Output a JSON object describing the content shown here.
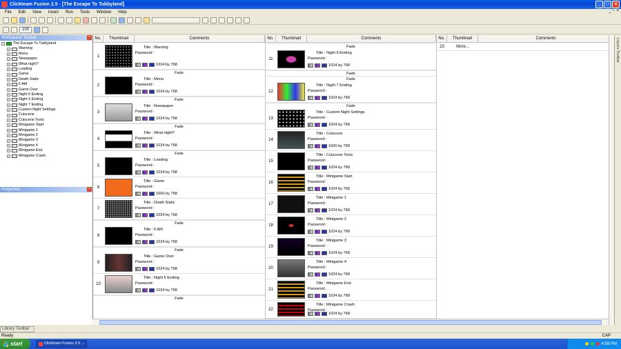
{
  "window": {
    "title": "Clickteam Fusion 2.5 - [The Escape To Tubbyland]"
  },
  "menu": [
    "File",
    "Edit",
    "View",
    "Insert",
    "Run",
    "Tools",
    "Window",
    "Help"
  ],
  "mdi_buttons": [
    "_",
    "▫",
    "×"
  ],
  "toolbar": {
    "zoom_value": "100"
  },
  "workspace": {
    "title": "Workspace Toolbar",
    "root": "The Escape To Tubbyland",
    "frames": [
      "Warning",
      "Menu",
      "Newspaper",
      "What night?",
      "Loading",
      "Game",
      "Death Static",
      "6 AM",
      "Game Over",
      "Night 5 Ending",
      "Night 6 Ending",
      "Night 7 Ending",
      "Custom Night Settings",
      "Cutscene",
      "Cutscene Texts",
      "Minigame Start",
      "Minigame 1",
      "Minigame 2",
      "Minigame 3",
      "Minigame 4",
      "Minigame End",
      "Minigame Crash"
    ]
  },
  "properties": {
    "title": "Properties"
  },
  "library": {
    "title": "Library Toolbar"
  },
  "layers": {
    "title": "Layers Toolbar"
  },
  "columns": {
    "no": "No.",
    "thumbnail": "Thumbnail",
    "comments": "Comments"
  },
  "labels": {
    "title_prefix": "Title : ",
    "password": "Password :",
    "by": " by "
  },
  "storyboard": [
    {
      "no": "1",
      "title": "Warning",
      "w": "1024",
      "h": "768",
      "trans_after": "Fade"
    },
    {
      "no": "2",
      "title": "Menu",
      "w": "1024",
      "h": "768",
      "trans_after": "Fade"
    },
    {
      "no": "3",
      "title": "Newspaper",
      "w": "1024",
      "h": "768",
      "trans_after": "Fade"
    },
    {
      "no": "4",
      "title": "What night?",
      "w": "1024",
      "h": "768",
      "trans_after": "Fade"
    },
    {
      "no": "5",
      "title": "Loading",
      "w": "1024",
      "h": "768"
    },
    {
      "no": "6",
      "title": "Game",
      "w": "1600",
      "h": "768"
    },
    {
      "no": "7",
      "title": "Death Static",
      "w": "1024",
      "h": "768",
      "trans_after": "Fade"
    },
    {
      "no": "8",
      "title": "6 AM",
      "w": "1024",
      "h": "768",
      "trans_after": "Fade"
    },
    {
      "no": "9",
      "title": "Game Over",
      "w": "1024",
      "h": "768"
    },
    {
      "no": "10",
      "title": "Night 5 Ending",
      "w": "1024",
      "h": "768",
      "trans_after": "Fade"
    },
    {
      "no": "11",
      "title": "Night 6 Ending",
      "w": "1024",
      "h": "768",
      "trans_before": "Fade",
      "trans_after": "Fade"
    },
    {
      "no": "12",
      "title": "Night 7 Ending",
      "w": "1024",
      "h": "768",
      "trans_before": "Fade",
      "trans_after": "Fade"
    },
    {
      "no": "13",
      "title": "Custom Night Settings",
      "w": "1024",
      "h": "768"
    },
    {
      "no": "14",
      "title": "Cutscene",
      "w": "1600",
      "h": "768"
    },
    {
      "no": "15",
      "title": "Cutscene Texts",
      "w": "1024",
      "h": "768"
    },
    {
      "no": "16",
      "title": "Minigame Start",
      "w": "1024",
      "h": "768"
    },
    {
      "no": "17",
      "title": "Minigame 1",
      "w": "1024",
      "h": "768"
    },
    {
      "no": "18",
      "title": "Minigame 2",
      "w": "1024",
      "h": "768"
    },
    {
      "no": "19",
      "title": "Minigame 3",
      "w": "1024",
      "h": "768"
    },
    {
      "no": "20",
      "title": "Minigame 4",
      "w": "1024",
      "h": "768"
    },
    {
      "no": "21",
      "title": "Minigame End",
      "w": "1024",
      "h": "768"
    },
    {
      "no": "22",
      "title": "Minigame Crash",
      "w": "1024",
      "h": "768"
    }
  ],
  "more": {
    "no": "23",
    "label": "More..."
  },
  "status": {
    "text": "Ready",
    "cap": "CAP"
  },
  "taskbar": {
    "start": "start",
    "task": "Clickteam Fusion 2.5 ...",
    "time": "4:59 PM"
  },
  "colors": {
    "title_blue": "#0a5ee8",
    "taskbar_blue": "#245edb",
    "start_green": "#3c9a3c",
    "selection_blue": "#c1d3fb"
  }
}
